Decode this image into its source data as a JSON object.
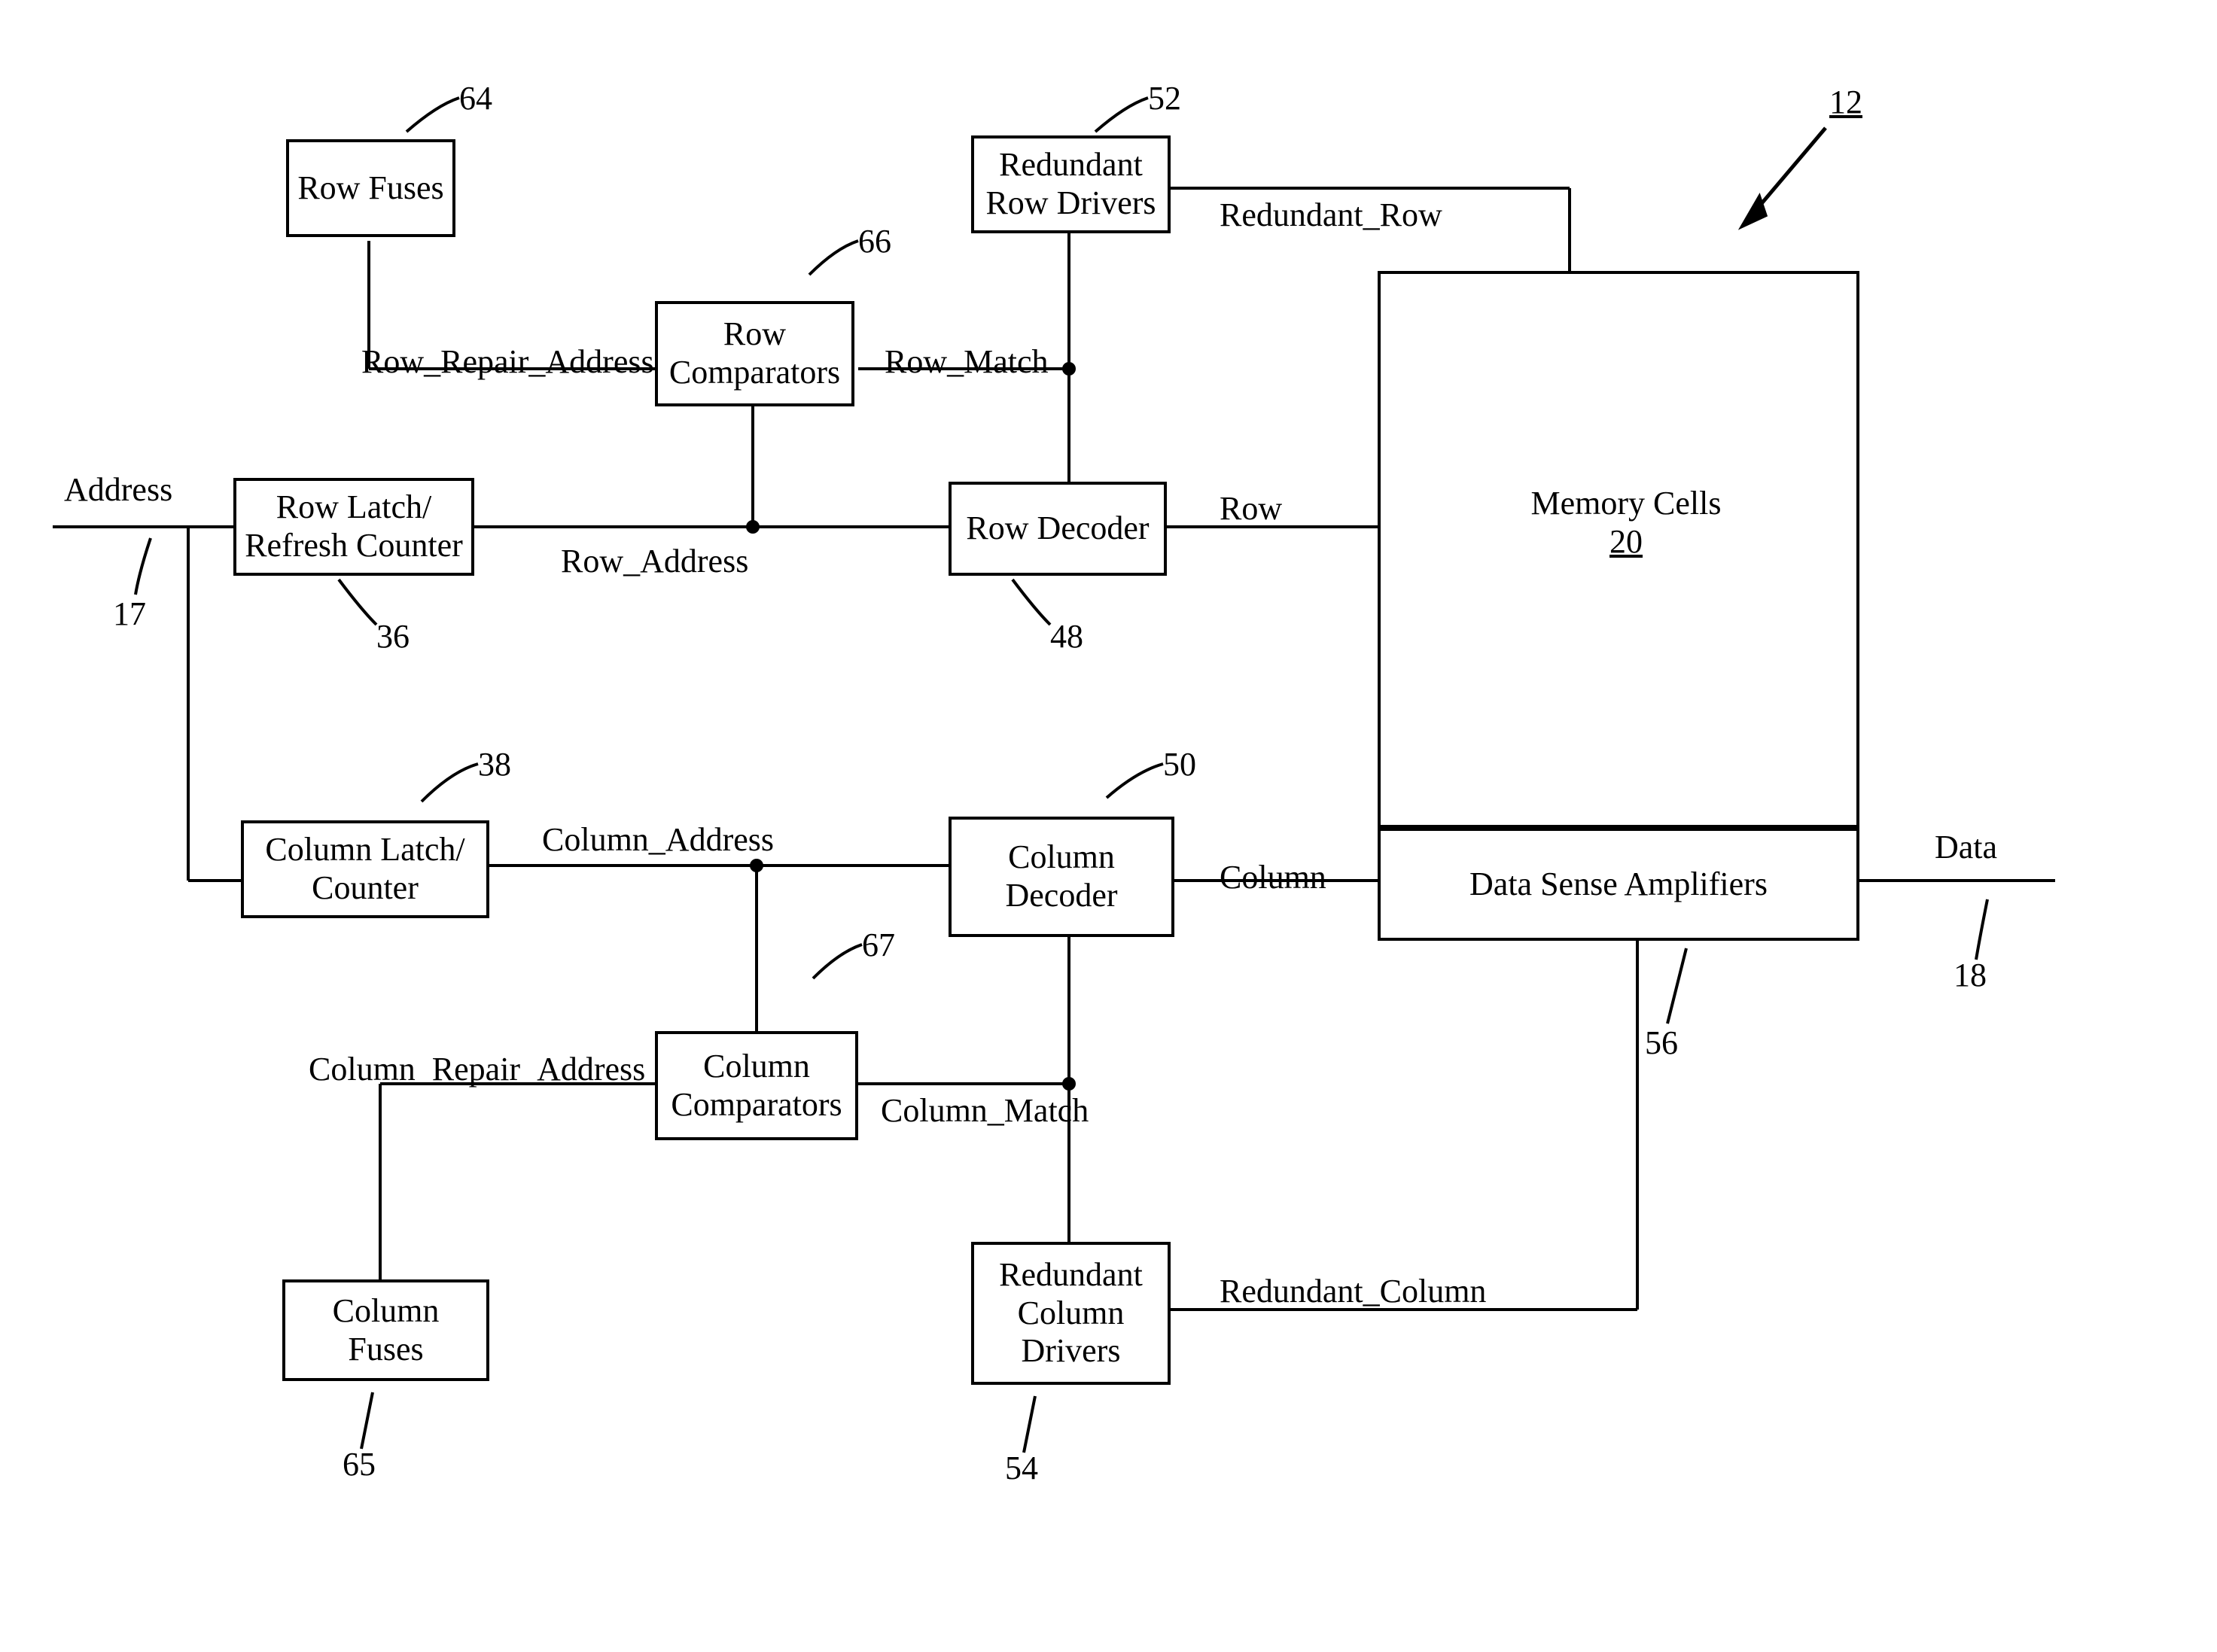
{
  "diagram_ref": "12",
  "blocks": {
    "row_fuses": {
      "label": "Row Fuses",
      "ref": "64"
    },
    "row_comparators": {
      "label": "Row\nComparators",
      "ref": "66"
    },
    "red_row_drivers": {
      "label": "Redundant\nRow Drivers",
      "ref": "52"
    },
    "row_latch": {
      "label": "Row Latch/\nRefresh Counter",
      "ref": "36"
    },
    "row_decoder": {
      "label": "Row Decoder",
      "ref": "48"
    },
    "col_latch": {
      "label": "Column Latch/\nCounter",
      "ref": "38"
    },
    "col_decoder": {
      "label": "Column\nDecoder",
      "ref": "50"
    },
    "col_comparators": {
      "label": "Column\nComparators",
      "ref": "67"
    },
    "col_fuses": {
      "label": "Column Fuses",
      "ref": "65"
    },
    "red_col_drivers": {
      "label": "Redundant\nColumn\nDrivers",
      "ref": "54"
    },
    "memory_cells": {
      "label": "Memory Cells",
      "ref": "20"
    },
    "sense_amps": {
      "label": "Data Sense Amplifiers",
      "ref": "56"
    }
  },
  "signals": {
    "address": "Address",
    "address_ref": "17",
    "row_repair_addr": "Row_Repair_Address",
    "row_match": "Row_Match",
    "row_address": "Row_Address",
    "row": "Row",
    "redundant_row": "Redundant_Row",
    "column_address": "Column_Address",
    "col_repair_addr": "Column_Repair_Address",
    "column_match": "Column_Match",
    "column": "Column",
    "redundant_column": "Redundant_Column",
    "data": "Data",
    "data_ref": "18"
  }
}
